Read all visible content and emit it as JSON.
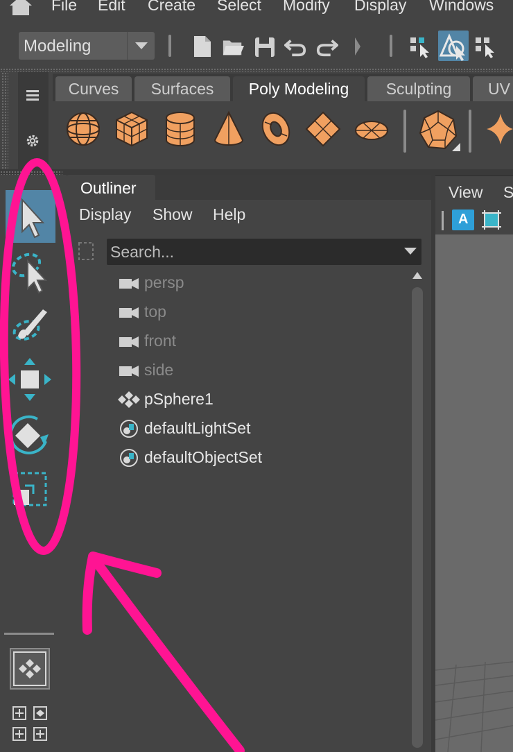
{
  "menubar": {
    "items": [
      "File",
      "Edit",
      "Create",
      "Select",
      "Modify",
      "Display",
      "Windows"
    ]
  },
  "statusline": {
    "mode": "Modeling"
  },
  "shelf": {
    "tabs": [
      "Curves",
      "Surfaces",
      "Poly Modeling",
      "Sculpting",
      "UV"
    ],
    "active_tab": "Poly Modeling",
    "icon_color": "#f0a060"
  },
  "outliner": {
    "tab_label": "Outliner",
    "menu": [
      "Display",
      "Show",
      "Help"
    ],
    "search_placeholder": "Search...",
    "items": [
      {
        "label": "persp",
        "icon": "camera-icon",
        "dim": true
      },
      {
        "label": "top",
        "icon": "camera-icon",
        "dim": true
      },
      {
        "label": "front",
        "icon": "camera-icon",
        "dim": true
      },
      {
        "label": "side",
        "icon": "camera-icon",
        "dim": true
      },
      {
        "label": "pSphere1",
        "icon": "transform-icon",
        "dim": false
      },
      {
        "label": "defaultLightSet",
        "icon": "set-icon",
        "dim": false
      },
      {
        "label": "defaultObjectSet",
        "icon": "set-icon",
        "dim": false
      }
    ]
  },
  "viewport": {
    "menu": [
      "View",
      "S"
    ],
    "badge_letter": "A"
  },
  "colors": {
    "accent": "#5285a6",
    "tool_cyan": "#3ab4c8",
    "annotation": "#ff1493"
  }
}
